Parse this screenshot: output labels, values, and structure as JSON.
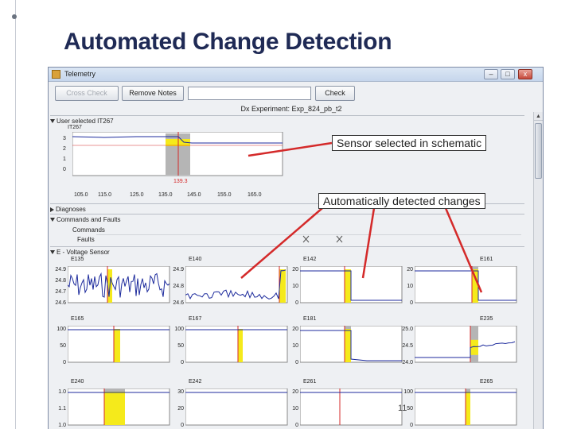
{
  "slide": {
    "title": "Automated Change Detection",
    "page_number": "11"
  },
  "window": {
    "title": "Telemetry",
    "minimize": "‒",
    "maximize": "□",
    "close": "x"
  },
  "toolbar": {
    "cross_check": "Cross Check",
    "remove_notes": "Remove Notes",
    "check": "Check",
    "input_value": ""
  },
  "experiment": "Dx Experiment: Exp_824_pb_t2",
  "sections": {
    "user_selected": "User selected IT267",
    "diagnoses": "Diagnoses",
    "commands_faults": "Commands and Faults",
    "commands_row": "Commands",
    "faults_row": "Faults",
    "voltage": "E - Voltage Sensor"
  },
  "main_plot": {
    "name": "IT267",
    "y_ticks": [
      "3",
      "2",
      "1",
      "0"
    ],
    "x_ticks": [
      "105.0",
      "115.0",
      "125.0",
      "135.0",
      "145.0",
      "155.0",
      "165.0"
    ],
    "marker": "139.3"
  },
  "callouts": {
    "sensor": "Sensor selected in schematic",
    "changes": "Automatically detected changes"
  },
  "sensor_panels": [
    {
      "name": "E135",
      "y_ticks": [
        "24.9",
        "24.8",
        "24.7",
        "24.6"
      ]
    },
    {
      "name": "E140",
      "y_ticks": [
        "24.9",
        "24.8",
        "24.6"
      ]
    },
    {
      "name": "E142",
      "y_ticks": [
        "20",
        "10",
        "0"
      ]
    },
    {
      "name": "E161",
      "y_ticks": [
        "20",
        "10",
        "0"
      ]
    },
    {
      "name": "E165",
      "y_ticks": [
        "100",
        "50",
        "0"
      ]
    },
    {
      "name": "E167",
      "y_ticks": [
        "100",
        "50",
        "0"
      ]
    },
    {
      "name": "E181",
      "y_ticks": [
        "20",
        "10",
        "0"
      ]
    },
    {
      "name": "E235",
      "y_ticks": [
        "25.0",
        "24.5",
        "24.0"
      ]
    },
    {
      "name": "E240",
      "y_ticks": [
        "1.0",
        "1.1",
        "1.0"
      ]
    },
    {
      "name": "E242",
      "y_ticks": [
        "30",
        "20",
        "0"
      ]
    },
    {
      "name": "E261",
      "y_ticks": [
        "20",
        "10",
        "0"
      ]
    },
    {
      "name": "E265",
      "y_ticks": [
        "100",
        "50",
        "0"
      ]
    }
  ],
  "colors": {
    "title": "#1f2a55",
    "highlight": "#f5ea1b",
    "gray_band": "#b5b5b5",
    "red_marker": "#d42a2a",
    "signal": "#1c2a9c"
  }
}
